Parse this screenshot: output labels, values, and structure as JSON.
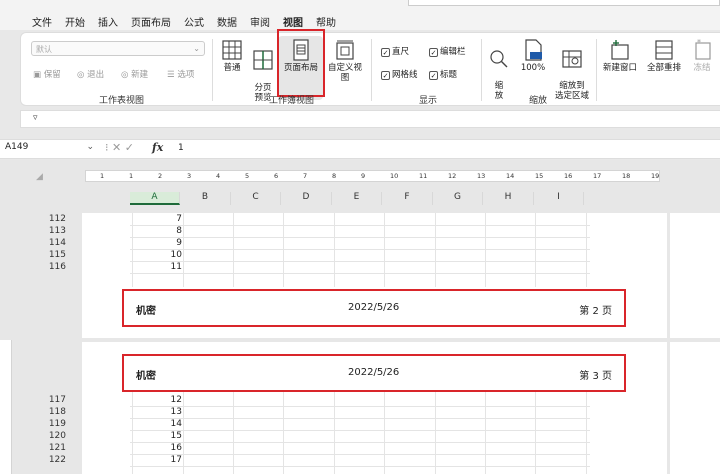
{
  "menu": {
    "items": [
      "文件",
      "开始",
      "插入",
      "页面布局",
      "公式",
      "数据",
      "审阅",
      "视图",
      "帮助"
    ],
    "active_index": 7
  },
  "ribbon": {
    "workbook_views": {
      "select_value": "默认",
      "keep_label": "保留",
      "exit_label": "退出",
      "new_label": "新建",
      "options_label": "选项",
      "group_label": "工作表视图"
    },
    "book_views": {
      "normal_label": "普通",
      "page_break_label": "分页\n预览",
      "page_layout_label": "页面布局",
      "custom_label": "自定义视图",
      "group_label": "工作簿视图"
    },
    "show": {
      "ruler_label": "直尺",
      "formula_bar_label": "编辑栏",
      "gridlines_label": "网格线",
      "headings_label": "标题",
      "group_label": "显示"
    },
    "zoom": {
      "zoom_label": "缩\n放",
      "hundred_label": "100%",
      "zoom_selection_label": "缩放到\n选定区域",
      "group_label": "缩放"
    },
    "window": {
      "new_window_label": "新建窗口",
      "arrange_all_label": "全部重排",
      "freeze_label": "冻结"
    }
  },
  "qat": {
    "icon": "▿"
  },
  "formula_bar": {
    "name_box": "A149",
    "icons": "⁝  ✕  ✓",
    "fx": "fx",
    "value": "1"
  },
  "ruler_numbers": [
    "1",
    "1",
    "2",
    "3",
    "4",
    "5",
    "6",
    "7",
    "8",
    "9",
    "10",
    "11",
    "12",
    "13",
    "14",
    "15",
    "16",
    "17",
    "18",
    "19"
  ],
  "columns": [
    "A",
    "B",
    "C",
    "D",
    "E",
    "F",
    "G",
    "H",
    "I"
  ],
  "page1": {
    "rows": [
      {
        "num": "112",
        "a": "7"
      },
      {
        "num": "113",
        "a": "8"
      },
      {
        "num": "114",
        "a": "9"
      },
      {
        "num": "115",
        "a": "10"
      },
      {
        "num": "116",
        "a": "11"
      }
    ],
    "footer": {
      "left": "机密",
      "center": "2022/5/26",
      "right": "第 2 页"
    }
  },
  "page2": {
    "header": {
      "left": "机密",
      "center": "2022/5/26",
      "right": "第 3 页"
    },
    "rows": [
      {
        "num": "117",
        "a": "12"
      },
      {
        "num": "118",
        "a": "13"
      },
      {
        "num": "119",
        "a": "14"
      },
      {
        "num": "120",
        "a": "15"
      },
      {
        "num": "121",
        "a": "16"
      },
      {
        "num": "122",
        "a": "17"
      }
    ]
  },
  "colors": {
    "accent_green": "#1e6b3a",
    "highlight_red": "#d9252a"
  }
}
